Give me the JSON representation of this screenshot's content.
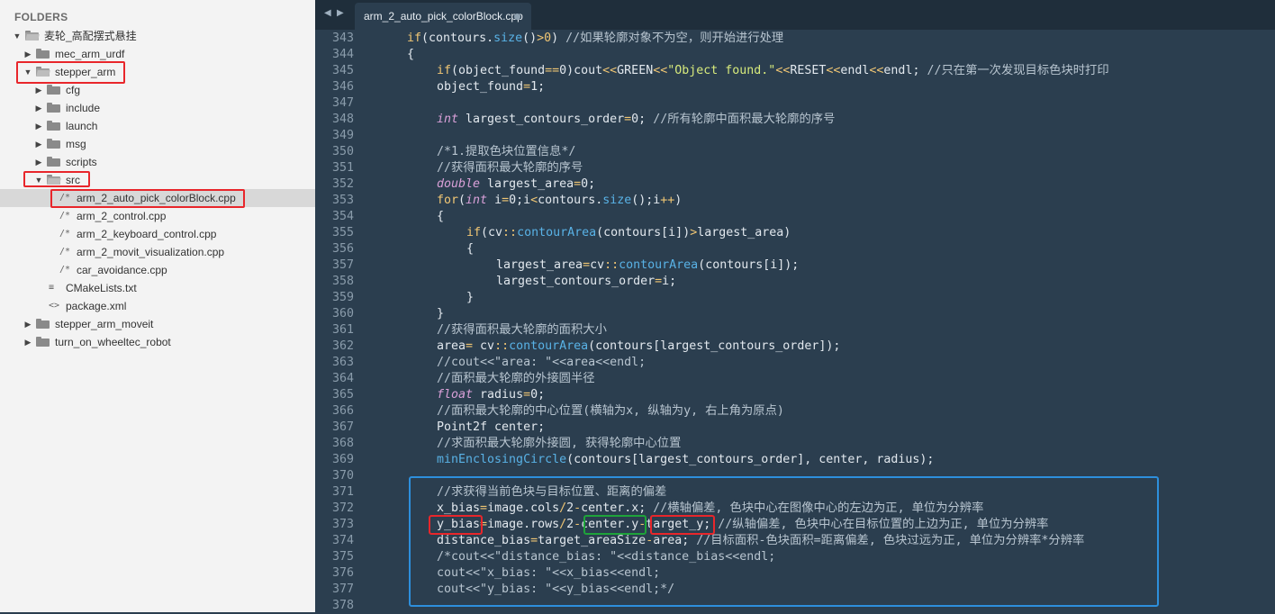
{
  "sidebar": {
    "title": "FOLDERS",
    "items": [
      {
        "label": "麦轮_高配摆式悬挂",
        "kind": "folder-open",
        "indent": 0,
        "expanded": true
      },
      {
        "label": "mec_arm_urdf",
        "kind": "folder",
        "indent": 1,
        "expanded": false
      },
      {
        "label": "stepper_arm",
        "kind": "folder-open",
        "indent": 1,
        "expanded": true
      },
      {
        "label": "cfg",
        "kind": "folder",
        "indent": 2,
        "expanded": false
      },
      {
        "label": "include",
        "kind": "folder",
        "indent": 2,
        "expanded": false
      },
      {
        "label": "launch",
        "kind": "folder",
        "indent": 2,
        "expanded": false
      },
      {
        "label": "msg",
        "kind": "folder",
        "indent": 2,
        "expanded": false
      },
      {
        "label": "scripts",
        "kind": "folder",
        "indent": 2,
        "expanded": false
      },
      {
        "label": "src",
        "kind": "folder-open",
        "indent": 2,
        "expanded": true
      },
      {
        "label": "arm_2_auto_pick_colorBlock.cpp",
        "kind": "file",
        "icon": "/*",
        "indent": 3,
        "selected": true
      },
      {
        "label": "arm_2_control.cpp",
        "kind": "file",
        "icon": "/*",
        "indent": 3
      },
      {
        "label": "arm_2_keyboard_control.cpp",
        "kind": "file",
        "icon": "/*",
        "indent": 3
      },
      {
        "label": "arm_2_movit_visualization.cpp",
        "kind": "file",
        "icon": "/*",
        "indent": 3
      },
      {
        "label": "car_avoidance.cpp",
        "kind": "file",
        "icon": "/*",
        "indent": 3
      },
      {
        "label": "CMakeLists.txt",
        "kind": "file",
        "icon": "≡",
        "indent": 2
      },
      {
        "label": "package.xml",
        "kind": "file",
        "icon": "<>",
        "indent": 2
      },
      {
        "label": "stepper_arm_moveit",
        "kind": "folder",
        "indent": 1,
        "expanded": false
      },
      {
        "label": "turn_on_wheeltec_robot",
        "kind": "folder",
        "indent": 1,
        "expanded": false
      }
    ]
  },
  "tabbar": {
    "active_tab": "arm_2_auto_pick_colorBlock.cpp",
    "nav_left": "◀",
    "nav_right": "▶"
  },
  "code": {
    "lines": [
      {
        "n": "343",
        "indent": 1,
        "t": [
          [
            "k",
            "if"
          ],
          [
            "p",
            "("
          ],
          [
            "p",
            "contours."
          ],
          [
            "fn",
            "size"
          ],
          [
            "p",
            "()"
          ],
          [
            "k",
            ">0"
          ],
          [
            "p",
            ") "
          ],
          [
            "c",
            "//如果轮廓对象不为空，则开始进行处理"
          ]
        ]
      },
      {
        "n": "344",
        "indent": 1,
        "t": [
          [
            "p",
            "{"
          ]
        ]
      },
      {
        "n": "345",
        "indent": 2,
        "t": [
          [
            "k",
            "if"
          ],
          [
            "p",
            "(object_found"
          ],
          [
            "k",
            "=="
          ],
          [
            "p",
            "0)cout"
          ],
          [
            "k",
            "<<"
          ],
          [
            "p",
            "GREEN"
          ],
          [
            "k",
            "<<"
          ],
          [
            "s",
            "\"Object found.\""
          ],
          [
            "k",
            "<<"
          ],
          [
            "p",
            "RESET"
          ],
          [
            "k",
            "<<"
          ],
          [
            "p",
            "endl"
          ],
          [
            "k",
            "<<"
          ],
          [
            "p",
            "endl; "
          ],
          [
            "c",
            "//只在第一次发现目标色块时打印"
          ]
        ]
      },
      {
        "n": "346",
        "indent": 2,
        "t": [
          [
            "p",
            "object_found"
          ],
          [
            "k",
            "="
          ],
          [
            "p",
            "1;"
          ]
        ]
      },
      {
        "n": "347",
        "indent": 0,
        "t": []
      },
      {
        "n": "348",
        "indent": 2,
        "t": [
          [
            "t",
            "int"
          ],
          [
            "p",
            " largest_contours_order"
          ],
          [
            "k",
            "="
          ],
          [
            "p",
            "0; "
          ],
          [
            "c",
            "//所有轮廓中面积最大轮廓的序号"
          ]
        ]
      },
      {
        "n": "349",
        "indent": 0,
        "t": []
      },
      {
        "n": "350",
        "indent": 2,
        "t": [
          [
            "c",
            "/*1.提取色块位置信息*/"
          ]
        ]
      },
      {
        "n": "351",
        "indent": 2,
        "t": [
          [
            "c",
            "//获得面积最大轮廓的序号"
          ]
        ]
      },
      {
        "n": "352",
        "indent": 2,
        "t": [
          [
            "t",
            "double"
          ],
          [
            "p",
            " largest_area"
          ],
          [
            "k",
            "="
          ],
          [
            "p",
            "0;"
          ]
        ]
      },
      {
        "n": "353",
        "indent": 2,
        "t": [
          [
            "k",
            "for"
          ],
          [
            "p",
            "("
          ],
          [
            "t",
            "int"
          ],
          [
            "p",
            " i"
          ],
          [
            "k",
            "="
          ],
          [
            "p",
            "0;i"
          ],
          [
            "k",
            "<"
          ],
          [
            "p",
            "contours."
          ],
          [
            "fn",
            "size"
          ],
          [
            "p",
            "();i"
          ],
          [
            "k",
            "++"
          ],
          [
            "p",
            ")"
          ]
        ]
      },
      {
        "n": "354",
        "indent": 2,
        "t": [
          [
            "p",
            "{"
          ]
        ]
      },
      {
        "n": "355",
        "indent": 3,
        "t": [
          [
            "k",
            "if"
          ],
          [
            "p",
            "(cv"
          ],
          [
            "k",
            "::"
          ],
          [
            "fn",
            "contourArea"
          ],
          [
            "p",
            "(contours[i])"
          ],
          [
            "k",
            ">"
          ],
          [
            "p",
            "largest_area)"
          ]
        ]
      },
      {
        "n": "356",
        "indent": 3,
        "t": [
          [
            "p",
            "{"
          ]
        ]
      },
      {
        "n": "357",
        "indent": 4,
        "t": [
          [
            "p",
            "largest_area"
          ],
          [
            "k",
            "="
          ],
          [
            "p",
            "cv"
          ],
          [
            "k",
            "::"
          ],
          [
            "fn",
            "contourArea"
          ],
          [
            "p",
            "(contours[i]);"
          ]
        ]
      },
      {
        "n": "358",
        "indent": 4,
        "t": [
          [
            "p",
            "largest_contours_order"
          ],
          [
            "k",
            "="
          ],
          [
            "p",
            "i;"
          ]
        ]
      },
      {
        "n": "359",
        "indent": 3,
        "t": [
          [
            "p",
            "}"
          ]
        ]
      },
      {
        "n": "360",
        "indent": 2,
        "t": [
          [
            "p",
            "}"
          ]
        ]
      },
      {
        "n": "361",
        "indent": 2,
        "t": [
          [
            "c",
            "//获得面积最大轮廓的面积大小"
          ]
        ]
      },
      {
        "n": "362",
        "indent": 2,
        "t": [
          [
            "p",
            "area"
          ],
          [
            "k",
            "="
          ],
          [
            "p",
            " cv"
          ],
          [
            "k",
            "::"
          ],
          [
            "fn",
            "contourArea"
          ],
          [
            "p",
            "(contours[largest_contours_order]);"
          ]
        ]
      },
      {
        "n": "363",
        "indent": 2,
        "t": [
          [
            "c",
            "//cout<<\"area: \"<<area<<endl;"
          ]
        ]
      },
      {
        "n": "364",
        "indent": 2,
        "t": [
          [
            "c",
            "//面积最大轮廓的外接圆半径"
          ]
        ]
      },
      {
        "n": "365",
        "indent": 2,
        "t": [
          [
            "t",
            "float"
          ],
          [
            "p",
            " radius"
          ],
          [
            "k",
            "="
          ],
          [
            "p",
            "0;"
          ]
        ]
      },
      {
        "n": "366",
        "indent": 2,
        "t": [
          [
            "c",
            "//面积最大轮廓的中心位置(横轴为x, 纵轴为y, 右上角为原点)"
          ]
        ]
      },
      {
        "n": "367",
        "indent": 2,
        "t": [
          [
            "p",
            "Point2f center;"
          ]
        ]
      },
      {
        "n": "368",
        "indent": 2,
        "t": [
          [
            "c",
            "//求面积最大轮廓外接圆, 获得轮廓中心位置"
          ]
        ]
      },
      {
        "n": "369",
        "indent": 2,
        "t": [
          [
            "fn",
            "minEnclosingCircle"
          ],
          [
            "p",
            "(contours[largest_contours_order], center, radius);"
          ]
        ]
      },
      {
        "n": "370",
        "indent": 0,
        "t": []
      },
      {
        "n": "371",
        "indent": 2,
        "t": [
          [
            "c",
            "//求获得当前色块与目标位置、距离的偏差"
          ]
        ]
      },
      {
        "n": "372",
        "indent": 2,
        "t": [
          [
            "p",
            "x_bias"
          ],
          [
            "k",
            "="
          ],
          [
            "p",
            "image.cols"
          ],
          [
            "k",
            "/"
          ],
          [
            "p",
            "2"
          ],
          [
            "k",
            "-"
          ],
          [
            "p",
            "center.x; "
          ],
          [
            "c",
            "//横轴偏差, 色块中心在图像中心的左边为正, 单位为分辨率"
          ]
        ]
      },
      {
        "n": "373",
        "indent": 2,
        "t": [
          [
            "p",
            "y_bias"
          ],
          [
            "k",
            "="
          ],
          [
            "p",
            "image.rows"
          ],
          [
            "k",
            "/"
          ],
          [
            "p",
            "2"
          ],
          [
            "k",
            "-"
          ],
          [
            "p",
            "center.y"
          ],
          [
            "k",
            "-"
          ],
          [
            "p",
            "target_y; "
          ],
          [
            "c",
            "//纵轴偏差, 色块中心在目标位置的上边为正, 单位为分辨率"
          ]
        ]
      },
      {
        "n": "374",
        "indent": 2,
        "t": [
          [
            "p",
            "distance_bias"
          ],
          [
            "k",
            "="
          ],
          [
            "p",
            "target_areaSize"
          ],
          [
            "k",
            "-"
          ],
          [
            "p",
            "area; "
          ],
          [
            "c",
            "//目标面积-色块面积=距离偏差, 色块过远为正, 单位为分辨率*分辨率"
          ]
        ]
      },
      {
        "n": "375",
        "indent": 2,
        "t": [
          [
            "c",
            "/*cout<<\"distance_bias: \"<<distance_bias<<endl;"
          ]
        ]
      },
      {
        "n": "376",
        "indent": 2,
        "t": [
          [
            "c",
            "cout<<\"x_bias: \"<<x_bias<<endl;"
          ]
        ]
      },
      {
        "n": "377",
        "indent": 2,
        "t": [
          [
            "c",
            "cout<<\"y_bias: \"<<y_bias<<endl;*/"
          ]
        ]
      },
      {
        "n": "378",
        "indent": 0,
        "t": []
      }
    ]
  },
  "colors": {
    "editor_bg": "#2b3e4f",
    "keyword": "#f0c674",
    "type": "#d9a0d8",
    "function": "#59b2e6",
    "string": "#d7ea7c",
    "comment": "#b7c4cf",
    "highlight_blue": "#2d8fdc",
    "highlight_red": "#e8262b",
    "highlight_green": "#1ea33a"
  }
}
